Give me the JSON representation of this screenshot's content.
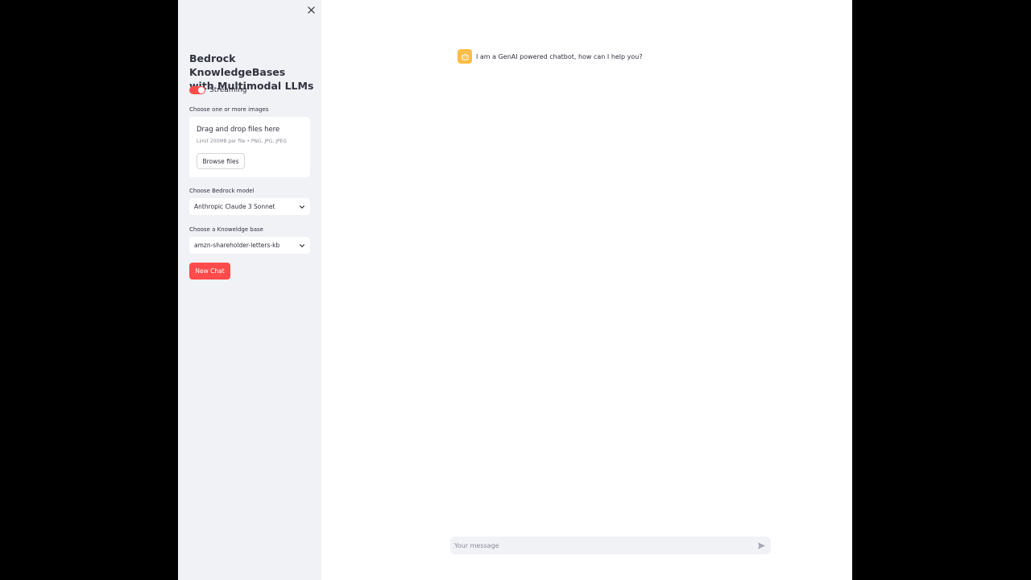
{
  "sidebar": {
    "title_line1": "Bedrock KnowledgeBases",
    "title_line2": "with Multimodal LLMs",
    "streaming_label": "Streaming",
    "streaming_on": true,
    "uploader": {
      "label": "Choose one or more images",
      "drop_text": "Drag and drop files here",
      "limit_text": "Limit 200MB per file • PNG, JPG, JPEG",
      "browse_label": "Browse files"
    },
    "model_select": {
      "label": "Choose Bedrock model",
      "value": "Anthropic Claude 3 Sonnet"
    },
    "kb_select": {
      "label": "Choose a Knoweldge base",
      "value": "amzn-shareholder-letters-kb"
    },
    "new_chat_label": "New Chat"
  },
  "chat": {
    "messages": [
      {
        "role": "assistant",
        "text": "I am a GenAI powered chatbot, how can I help you?"
      }
    ],
    "input_placeholder": "Your message"
  },
  "colors": {
    "accent": "#ff4b4b",
    "sidebar_bg": "#f0f2f6",
    "avatar_bg": "#ffbd45",
    "text": "#31333f"
  }
}
